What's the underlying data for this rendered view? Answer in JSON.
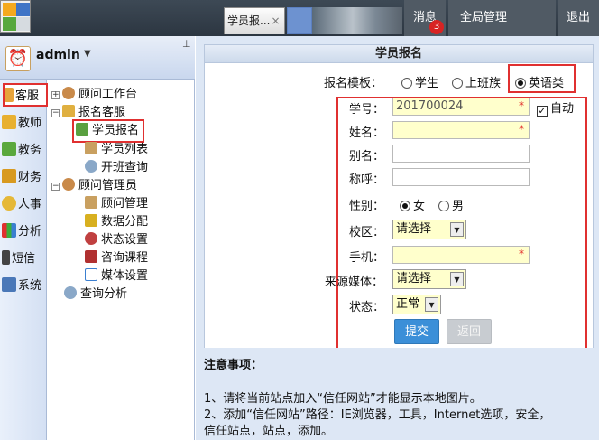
{
  "topbar": {
    "tab_label": "学员报...",
    "tab_close": "×",
    "nav_message": "消息",
    "nav_badge": "3",
    "nav_global": "全局管理",
    "nav_exit": "退出"
  },
  "user": {
    "name": "admin",
    "arrow": "▼",
    "pin": "⊥"
  },
  "leftcol": [
    {
      "label": "客服",
      "icon": "pencil-icon",
      "color": "#e6a33a"
    },
    {
      "label": "教师",
      "icon": "teacher-icon",
      "color": "#e8b030"
    },
    {
      "label": "教务",
      "icon": "academic-icon",
      "color": "#5aa83d"
    },
    {
      "label": "财务",
      "icon": "finance-icon",
      "color": "#d89a20"
    },
    {
      "label": "人事",
      "icon": "hr-icon",
      "color": "#e5b838"
    },
    {
      "label": "分析",
      "icon": "chart-icon",
      "color": "#3b7fd0"
    },
    {
      "label": "短信",
      "icon": "phone-icon",
      "color": "#444444"
    },
    {
      "label": "系统",
      "icon": "system-icon",
      "color": "#4a78b8"
    }
  ],
  "tree": {
    "n1": "顾问工作台",
    "n2": "报名客服",
    "n2a": "学员报名",
    "n2b": "学员列表",
    "n2c": "开班查询",
    "n3": "顾问管理员",
    "n3a": "顾问管理",
    "n3b": "数据分配",
    "n3c": "状态设置",
    "n3d": "咨询课程",
    "n3e": "媒体设置",
    "n4": "查询分析"
  },
  "form": {
    "title": "学员报名",
    "template_label": "报名模板：",
    "tpl_student": "学生",
    "tpl_worker": "上班族",
    "tpl_english": "英语类",
    "student_no_label": "学号：",
    "student_no_value": "201700024",
    "auto_label": "自动",
    "auto_check": "✓",
    "name_label": "姓名：",
    "alias_label": "别名：",
    "title_label": "称呼：",
    "gender_label": "性别：",
    "gender_female": "女",
    "gender_male": "男",
    "campus_label": "校区：",
    "campus_value": "请选择",
    "phone_label": "手机：",
    "source_label": "来源媒体：",
    "source_value": "请选择",
    "status_label": "状态：",
    "status_value": "正常",
    "required_mark": "*",
    "select_arrow": "▼",
    "submit": "提交",
    "back": "返回"
  },
  "notes": {
    "title": "注意事项：",
    "line1": "1、请将当前站点加入“信任网站”才能显示本地图片。",
    "line2": "2、添加“信任网站”路径：IE浏览器，工具，Internet选项，安全，",
    "line3": "信任站点，站点，添加。"
  }
}
